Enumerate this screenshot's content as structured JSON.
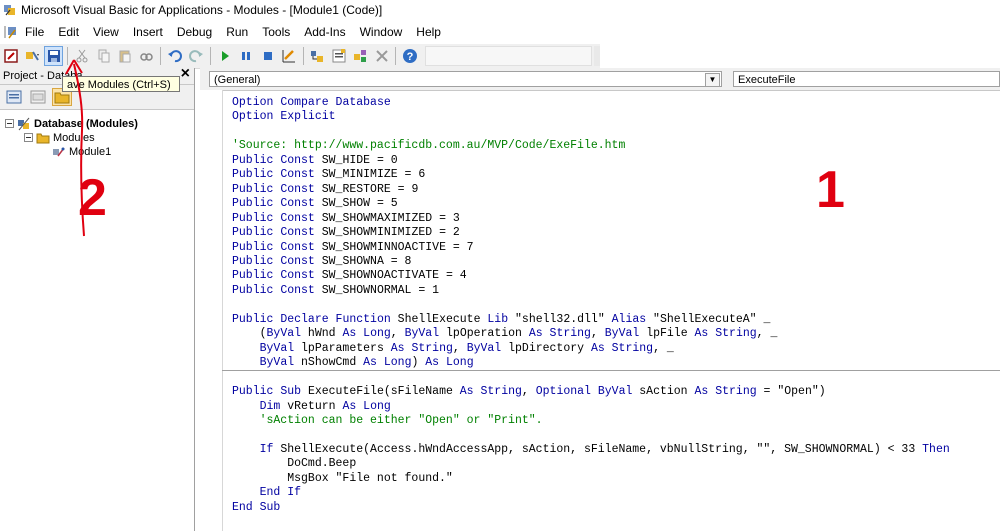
{
  "window": {
    "title": "Microsoft Visual Basic for Applications - Modules - [Module1 (Code)]"
  },
  "menu": [
    {
      "label": "File"
    },
    {
      "label": "Edit"
    },
    {
      "label": "View"
    },
    {
      "label": "Insert"
    },
    {
      "label": "Debug"
    },
    {
      "label": "Run"
    },
    {
      "label": "Tools"
    },
    {
      "label": "Add-Ins"
    },
    {
      "label": "Window"
    },
    {
      "label": "Help"
    }
  ],
  "toolbar": {
    "icons": [
      "view-access-icon",
      "insert-module-icon",
      "save-icon",
      "cut-icon",
      "copy-icon",
      "paste-icon",
      "find-icon",
      "undo-icon",
      "redo-icon",
      "run-icon",
      "break-icon",
      "reset-icon",
      "design-mode-icon",
      "project-explorer-icon",
      "properties-icon",
      "object-browser-icon",
      "toolbox-icon",
      "help-icon"
    ]
  },
  "project_panel": {
    "title": "Project - Databa",
    "tooltip": "ave Modules (Ctrl+S)",
    "tree": {
      "root": "Database (Modules)",
      "folder": "Modules",
      "item": "Module1"
    }
  },
  "code_window": {
    "object_combo": "(General)",
    "procedure_combo": "ExecuteFile",
    "lines": [
      "Option Compare Database",
      "Option Explicit",
      "",
      "'Source: http://www.pacificdb.com.au/MVP/Code/ExeFile.htm",
      "Public Const SW_HIDE = 0",
      "Public Const SW_MINIMIZE = 6",
      "Public Const SW_RESTORE = 9",
      "Public Const SW_SHOW = 5",
      "Public Const SW_SHOWMAXIMIZED = 3",
      "Public Const SW_SHOWMINIMIZED = 2",
      "Public Const SW_SHOWMINNOACTIVE = 7",
      "Public Const SW_SHOWNA = 8",
      "Public Const SW_SHOWNOACTIVATE = 4",
      "Public Const SW_SHOWNORMAL = 1",
      "",
      "Public Declare Function ShellExecute Lib \"shell32.dll\" Alias \"ShellExecuteA\" _",
      "    (ByVal hWnd As Long, ByVal lpOperation As String, ByVal lpFile As String, _",
      "    ByVal lpParameters As String, ByVal lpDirectory As String, _",
      "    ByVal nShowCmd As Long) As Long",
      "",
      "Public Sub ExecuteFile(sFileName As String, Optional ByVal sAction As String = \"Open\")",
      "    Dim vReturn As Long",
      "    'sAction can be either \"Open\" or \"Print\".",
      "",
      "    If ShellExecute(Access.hWndAccessApp, sAction, sFileName, vbNullString, \"\", SW_SHOWNORMAL) < 33 Then",
      "        DoCmd.Beep",
      "        MsgBox \"File not found.\"",
      "    End If",
      "End Sub"
    ]
  },
  "annotations": {
    "one": "1",
    "two": "2"
  },
  "colors": {
    "keyword": "#0000a0",
    "comment": "#008000",
    "annotation": "#e00010"
  }
}
